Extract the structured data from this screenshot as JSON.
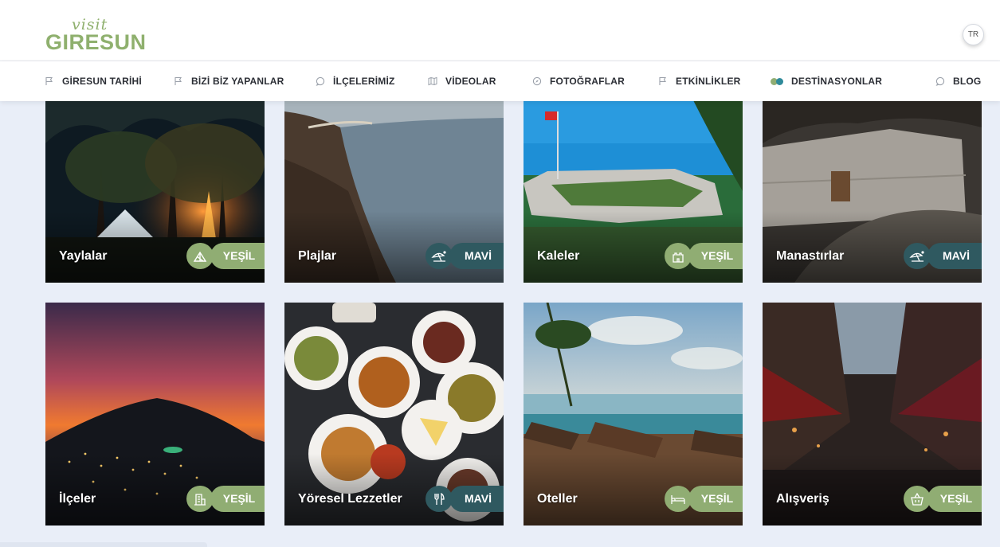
{
  "header": {
    "logo_script": "visit",
    "logo_name": "GIRESUN",
    "language": "TR"
  },
  "nav": {
    "items": [
      {
        "label": "GİRESUN TARİHİ",
        "icon": "flag-icon"
      },
      {
        "label": "BİZİ BİZ YAPANLAR",
        "icon": "flag-icon"
      },
      {
        "label": "İLÇELERİMİZ",
        "icon": "chat-icon"
      },
      {
        "label": "VİDEOLAR",
        "icon": "map-icon"
      },
      {
        "label": "FOTOĞRAFLAR",
        "icon": "compass-icon"
      },
      {
        "label": "ETKİNLİKLER",
        "icon": "flag-icon"
      },
      {
        "label": "DESTİNASYONLAR",
        "icon": "dots-icon"
      },
      {
        "label": "BLOG",
        "icon": "chat-icon"
      }
    ]
  },
  "colors": {
    "green": "#90ad73",
    "blue": "#2f5960",
    "background": "#e9eef8"
  },
  "cards": [
    {
      "title": "Yaylalar",
      "badge": "YEŞİL",
      "theme": "green",
      "icon": "camping-icon"
    },
    {
      "title": "Plajlar",
      "badge": "MAVİ",
      "theme": "blue",
      "icon": "beach-icon"
    },
    {
      "title": "Kaleler",
      "badge": "YEŞİL",
      "theme": "green",
      "icon": "castle-icon"
    },
    {
      "title": "Manastırlar",
      "badge": "MAVİ",
      "theme": "blue",
      "icon": "beach-icon"
    },
    {
      "title": "İlçeler",
      "badge": "YEŞİL",
      "theme": "green",
      "icon": "building-icon"
    },
    {
      "title": "Yöresel Lezzetler",
      "badge": "MAVİ",
      "theme": "blue",
      "icon": "cutlery-icon"
    },
    {
      "title": "Oteller",
      "badge": "YEŞİL",
      "theme": "green",
      "icon": "bed-icon"
    },
    {
      "title": "Alışveriş",
      "badge": "YEŞİL",
      "theme": "green",
      "icon": "basket-icon"
    }
  ]
}
